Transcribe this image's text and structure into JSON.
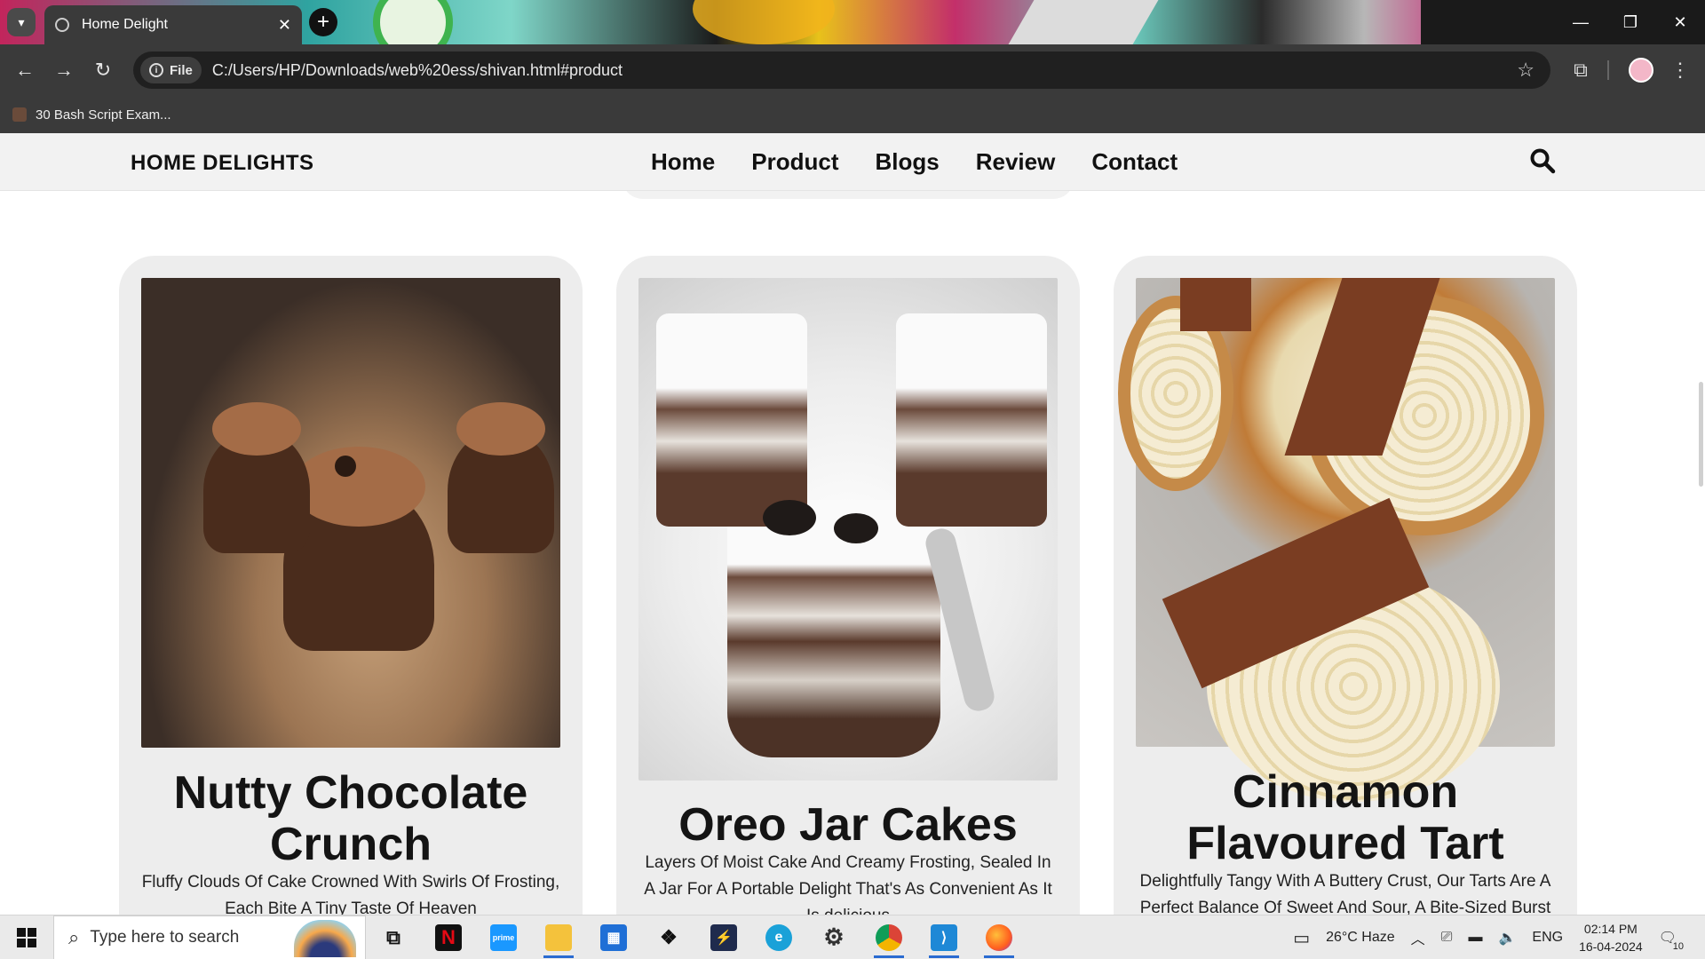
{
  "browser": {
    "tab_title": "Home Delight",
    "url_chip": "File",
    "url": "C:/Users/HP/Downloads/web%20ess/shivan.html#product",
    "bookmark": "30 Bash Script Exam..."
  },
  "site": {
    "brand": "HOME DELIGHTS",
    "nav": [
      "Home",
      "Product",
      "Blogs",
      "Review",
      "Contact"
    ]
  },
  "products": [
    {
      "name": "Nutty Chocolate Crunch",
      "description": "Fluffy Clouds Of Cake Crowned With Swirls Of Frosting, Each Bite A Tiny Taste Of Heaven"
    },
    {
      "name": "Oreo Jar Cakes",
      "description": "Layers Of Moist Cake And Creamy Frosting, Sealed In A Jar For A Portable Delight That's As Convenient As It Is delicious"
    },
    {
      "name": "Cinnamon Flavoured Tart",
      "description": "Delightfully Tangy With A Buttery Crust, Our Tarts Are A Perfect Balance Of Sweet And Sour, A Bite-Sized Burst"
    }
  ],
  "taskbar": {
    "search_placeholder": "Type here to search",
    "weather": "26°C  Haze",
    "lang": "ENG",
    "time": "02:14 PM",
    "date": "16-04-2024",
    "notifications": "10"
  }
}
